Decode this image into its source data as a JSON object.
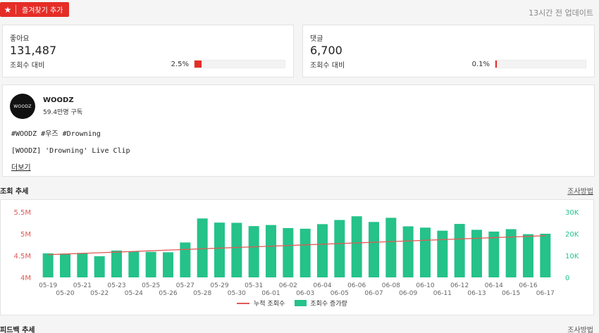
{
  "header": {
    "favorite_label": "즐겨찾기 추가",
    "updated": "13시간 전 업데이트"
  },
  "likes": {
    "label": "좋아요",
    "value": "131,487",
    "sub_label": "조회수 대비",
    "percent_text": "2.5%",
    "percent": 2.5
  },
  "comments": {
    "label": "댓글",
    "value": "6,700",
    "sub_label": "조회수 대비",
    "percent_text": "0.1%",
    "percent": 0.1
  },
  "video": {
    "channel_logo_text": "WOODZ",
    "channel_name": "WOODZ",
    "subscribers": "59.4만명 구독",
    "tags": "#WOODZ #우즈 #Drowning",
    "title": "[WOODZ] 'Drowning' Live Clip",
    "more_label": "더보기"
  },
  "views_section": {
    "title": "조회 추세",
    "method_label": "조사방법"
  },
  "feedback_section": {
    "title": "피드백 추세",
    "method_label": "조사방법"
  },
  "colors": {
    "accent_red": "#e52d27",
    "bar_green": "#25c28a",
    "line_red": "#e05a57"
  },
  "chart_data": {
    "type": "bar",
    "categories": [
      "05-19",
      "05-20",
      "05-21",
      "05-22",
      "05-23",
      "05-24",
      "05-25",
      "05-26",
      "05-27",
      "05-28",
      "05-29",
      "05-30",
      "05-31",
      "06-01",
      "06-02",
      "06-03",
      "06-04",
      "06-05",
      "06-06",
      "06-07",
      "06-08",
      "06-09",
      "06-10",
      "06-11",
      "06-12",
      "06-13",
      "06-14",
      "06-15",
      "06-16",
      "06-17"
    ],
    "left_axis": {
      "ticks": [
        "4M",
        "4.5M",
        "5M",
        "5.5M"
      ],
      "ylim": [
        4000000,
        5500000
      ]
    },
    "right_axis": {
      "ticks": [
        "0",
        "10K",
        "20K",
        "30K"
      ],
      "ylim": [
        0,
        30000
      ]
    },
    "series": [
      {
        "name": "누적 조회수",
        "type": "line",
        "axis": "left",
        "values": [
          4520000,
          4535000,
          4550000,
          4565000,
          4580000,
          4595000,
          4610000,
          4625000,
          4640000,
          4655000,
          4670000,
          4685000,
          4700000,
          4715000,
          4730000,
          4745000,
          4760000,
          4775000,
          4790000,
          4805000,
          4820000,
          4835000,
          4850000,
          4865000,
          4880000,
          4895000,
          4910000,
          4925000,
          4940000,
          4955000
        ]
      },
      {
        "name": "조회수 증가량",
        "type": "bar",
        "axis": "right",
        "values": [
          11000,
          10900,
          11200,
          9700,
          12300,
          11800,
          11700,
          11500,
          16000,
          27000,
          25100,
          25000,
          23500,
          24000,
          22600,
          22300,
          24400,
          26300,
          28000,
          25400,
          27300,
          23400,
          22800,
          21400,
          24500,
          21800,
          21000,
          22100,
          19800,
          20000
        ]
      }
    ],
    "legend_position": "bottom",
    "grid": false
  }
}
